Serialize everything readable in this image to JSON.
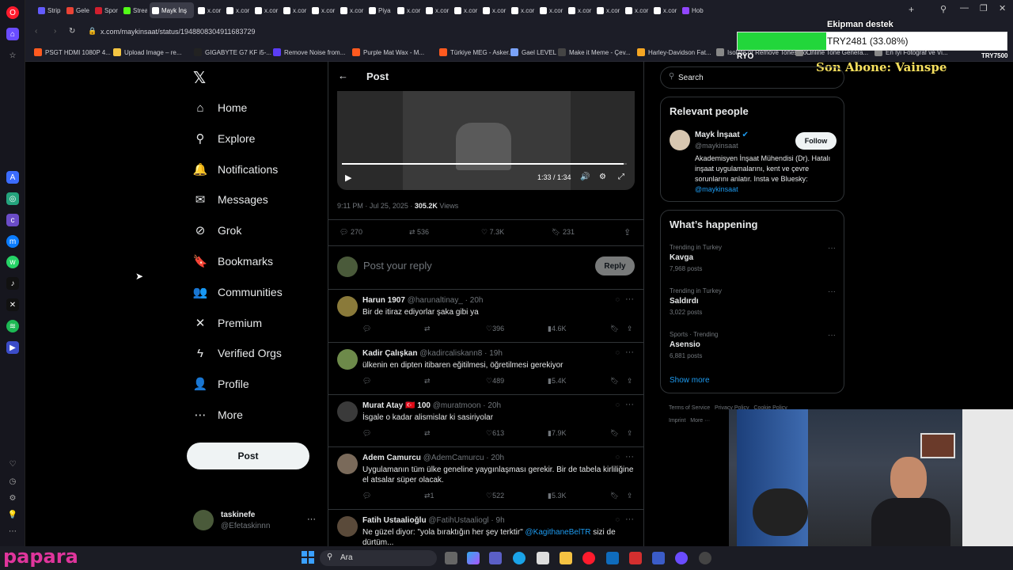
{
  "browser": {
    "tabs": [
      {
        "label": "Strip",
        "color": "#635bff"
      },
      {
        "label": "Gele",
        "color": "#ea4335"
      },
      {
        "label": "Spor",
        "color": "#d11f2e"
      },
      {
        "label": "Strea",
        "color": "#53fc18"
      },
      {
        "label": "Mayk İnş",
        "color": "#ffffff",
        "active": true
      },
      {
        "label": "x.cor",
        "color": "#ffffff"
      },
      {
        "label": "x.cor",
        "color": "#ffffff"
      },
      {
        "label": "x.cor",
        "color": "#ffffff"
      },
      {
        "label": "x.cor",
        "color": "#ffffff"
      },
      {
        "label": "x.cor",
        "color": "#ffffff"
      },
      {
        "label": "x.cor",
        "color": "#ffffff"
      },
      {
        "label": "Piya",
        "color": "#ffffff"
      },
      {
        "label": "x.cor",
        "color": "#ffffff"
      },
      {
        "label": "x.cor",
        "color": "#ffffff"
      },
      {
        "label": "x.cor",
        "color": "#ffffff"
      },
      {
        "label": "x.cor",
        "color": "#ffffff"
      },
      {
        "label": "x.cor",
        "color": "#ffffff"
      },
      {
        "label": "x.cor",
        "color": "#ffffff"
      },
      {
        "label": "x.cor",
        "color": "#ffffff"
      },
      {
        "label": "x.cor",
        "color": "#ffffff"
      },
      {
        "label": "x.cor",
        "color": "#ffffff"
      },
      {
        "label": "x.cor",
        "color": "#ffffff"
      },
      {
        "label": "Hob",
        "color": "#9146ff"
      }
    ],
    "url": "x.com/maykinsaat/status/1948808304911683729",
    "bookmarks": [
      {
        "label": "PSGT HDMI 1080P 4...",
        "color": "#ff5a1f"
      },
      {
        "label": "Upload Image – re...",
        "color": "#f4c542"
      },
      {
        "label": "GIGABYTE G7 KF i5-...",
        "color": "#222222"
      },
      {
        "label": "Remove Noise from...",
        "color": "#5b3df5"
      },
      {
        "label": "Purple Mat Wax - M...",
        "color": "#ff5a1f"
      },
      {
        "label": "Türkiye MEG - Asker...",
        "color": "#ff5a1f"
      },
      {
        "label": "Gael LEVEL",
        "color": "#7aa2f7"
      },
      {
        "label": "Make it Meme - Çev...",
        "color": "#444444"
      },
      {
        "label": "Harley-Davidson Fat...",
        "color": "#f5a623"
      },
      {
        "label": "Isolate or Remove Tones So...",
        "color": "#888888"
      },
      {
        "label": "Online Tone Genera...",
        "color": "#888888"
      },
      {
        "label": "En İyi Fotoğraf ve Vi...",
        "color": "#888888"
      }
    ]
  },
  "overlay": {
    "donation_title": "Ekipman destek",
    "donation_amount": "TRY2481 (33.08%)",
    "donation_progress": 0.3308,
    "donation_start": "RYO",
    "donation_goal": "TRY7500",
    "last_sub": "Son Abone: Vainspe",
    "brand": "papara"
  },
  "nav": {
    "items": [
      {
        "label": "Home",
        "icon": "⌂",
        "name": "home"
      },
      {
        "label": "Explore",
        "icon": "⚲",
        "name": "explore"
      },
      {
        "label": "Notifications",
        "icon": "🔔",
        "name": "notifications"
      },
      {
        "label": "Messages",
        "icon": "✉",
        "name": "messages"
      },
      {
        "label": "Grok",
        "icon": "⊘",
        "name": "grok"
      },
      {
        "label": "Bookmarks",
        "icon": "🔖",
        "name": "bookmarks"
      },
      {
        "label": "Communities",
        "icon": "👥",
        "name": "communities"
      },
      {
        "label": "Premium",
        "icon": "✕",
        "name": "premium"
      },
      {
        "label": "Verified Orgs",
        "icon": "ϟ",
        "name": "verified-orgs"
      },
      {
        "label": "Profile",
        "icon": "👤",
        "name": "profile"
      },
      {
        "label": "More",
        "icon": "⋯",
        "name": "more"
      }
    ],
    "post_button": "Post",
    "account_name": "taskinefe",
    "account_handle": "@Efetaskinnn"
  },
  "post": {
    "header_title": "Post",
    "video_time": "1:33 / 1:34",
    "video_progress": 0.99,
    "timestamp": "9:11 PM · Jul 25, 2025 · ",
    "views_count": "305.2K",
    "views_label": " Views",
    "replies": "270",
    "reposts": "536",
    "likes": "7.3K",
    "bookmarks": "231",
    "reply_placeholder": "Post your reply",
    "reply_button": "Reply"
  },
  "replies": [
    {
      "name": "Harun 1907",
      "handle": "@harunaltinay_ · 20h",
      "text": "Bir de itiraz ediyorlar şaka gibi ya",
      "reposts": "",
      "likes": "396",
      "views": "4.6K",
      "avatar": "#8a7a3a"
    },
    {
      "name": "Kadir Çalışkan",
      "handle": "@kadircaliskann8 · 19h",
      "text": "ülkenin en dipten itibaren eğitilmesi, öğretilmesi gerekiyor",
      "reposts": "",
      "likes": "489",
      "views": "5.4K",
      "avatar": "#6d8a4a"
    },
    {
      "name": "Murat Atay 🇹🇷 100",
      "handle": "@muratmoon · 20h",
      "text": "İsgale o kadar alismislar ki sasiriyolar",
      "reposts": "",
      "likes": "613",
      "views": "7.9K",
      "avatar": "#3a3a3a"
    },
    {
      "name": "Adem Camurcu",
      "handle": "@AdemCamurcu · 20h",
      "text": "Uygulamanın tüm ülke geneline yaygınlaşması gerekir. Bir de tabela kirliliğine el atsalar süper olacak.",
      "reposts": "1",
      "likes": "522",
      "views": "5.3K",
      "avatar": "#7a6a5a"
    },
    {
      "name": "Fatih Ustaalioğlu",
      "handle": "@FatihUstaaliogl · 9h",
      "text": "Ne güzel diyor: \"yola bıraktığın her şey terktir\" ",
      "mention": "@KagithaneBelTR",
      "text2": " sizi de dürtüm...",
      "avatar": "#5a4a3a"
    }
  ],
  "right": {
    "search_placeholder": "Search",
    "relevant_title": "Relevant people",
    "person_name": "Mayk İnşaat",
    "person_handle": "@maykinsaat",
    "follow": "Follow",
    "bio": "Akademisyen İnşaat Mühendisi (Dr). Hatalı inşaat uygulamalarını, kent ve çevre sorunlarını anlatır. Insta ve Bluesky: ",
    "bio_mention": "@maykinsaat",
    "happening_title": "What’s happening",
    "trends": [
      {
        "category": "Trending in Turkey",
        "title": "Kavga",
        "count": "7,968 posts"
      },
      {
        "category": "Trending in Turkey",
        "title": "Saldırdı",
        "count": "3,022 posts"
      },
      {
        "category": "Sports · Trending",
        "title": "Asensio",
        "count": "6,881 posts"
      }
    ],
    "show_more": "Show more",
    "footer1": "Terms of Service",
    "footer2": "Privacy Policy",
    "footer3": "Cookie Policy",
    "footer4": "Imprint",
    "footer5": "More ···"
  },
  "taskbar": {
    "search": "Ara"
  },
  "colors": {
    "accent": "#1d9bf0",
    "verified": "#1d9bf0"
  }
}
